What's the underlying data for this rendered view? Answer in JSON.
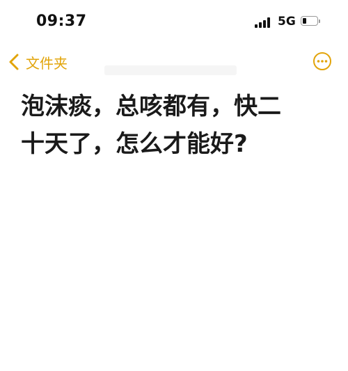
{
  "status_bar": {
    "time": "09:37",
    "network": "5G",
    "signal_icon": "cellular-signal-icon",
    "battery_icon": "battery-icon",
    "battery_level": 0.25
  },
  "nav": {
    "back_label": "文件夹",
    "back_icon": "chevron-left-icon",
    "more_icon": "ellipsis-circle-icon",
    "accent_color": "#e2a40a"
  },
  "note": {
    "text": "泡沫痰，总咳都有，快二\n十天了，怎么才能好?"
  }
}
